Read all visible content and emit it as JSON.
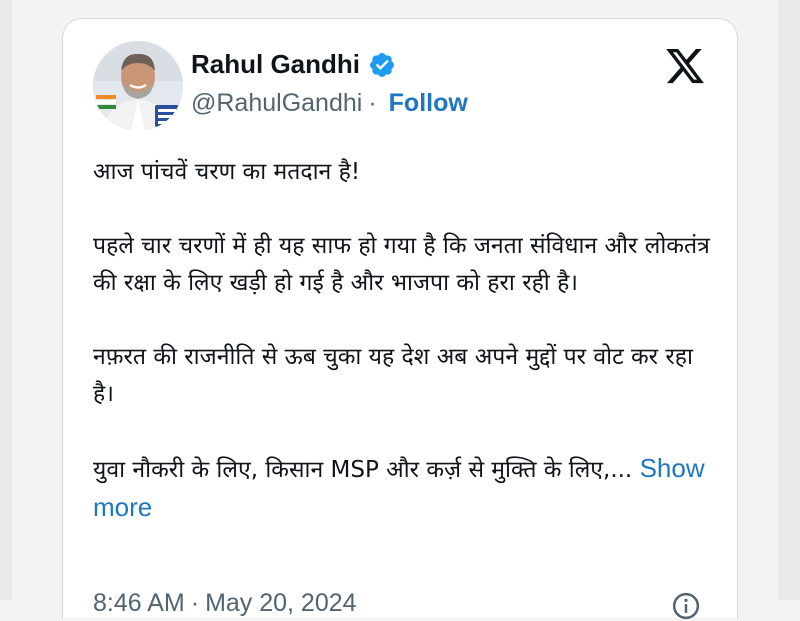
{
  "tweet": {
    "author_name": "Rahul Gandhi",
    "handle": "@RahulGandhi",
    "separator": "·",
    "follow_label": "Follow",
    "paragraphs": [
      "आज पांचवें चरण का मतदान है!",
      "पहले चार चरणों में ही यह साफ हो गया है कि जनता संविधान और लोकतंत्र की रक्षा के लिए खड़ी हो गई है और भाजपा को हरा रही है।",
      "नफ़रत की राजनीति से ऊब चुका यह देश अब अपने मुद्दों पर वोट कर रहा है।"
    ],
    "last_paragraph": "युवा नौकरी के लिए, किसान MSP और कर्ज़ से मुक्ति के लिए,...",
    "show_more_label": "Show more",
    "time": "8:46 AM",
    "date": "May 20, 2024"
  },
  "icons": {
    "verified": "verified-badge-icon",
    "platform": "x-logo-icon",
    "info": "info-icon"
  },
  "colors": {
    "link": "#1d77c2",
    "verified": "#1d9bf0",
    "secondary_text": "#536471",
    "primary_text": "#0f1419"
  }
}
